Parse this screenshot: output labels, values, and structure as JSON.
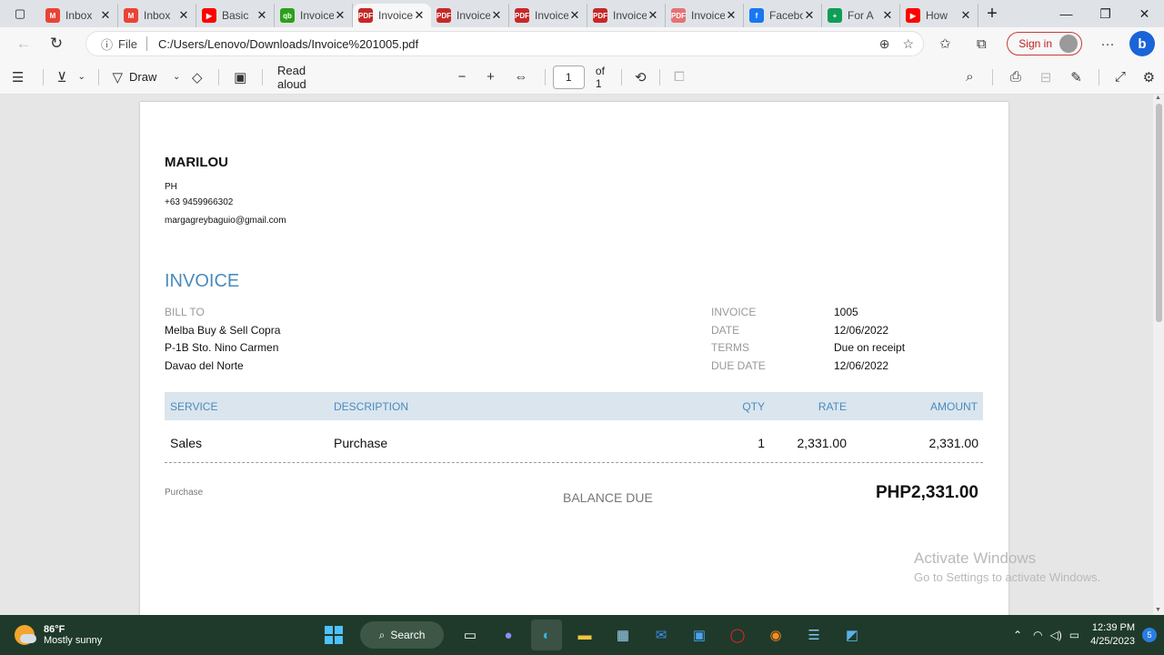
{
  "browser": {
    "tabs": [
      {
        "title": "Inbox",
        "favicon": "gmail-icon",
        "color": "#ea4335",
        "glyph": "M"
      },
      {
        "title": "Inbox",
        "favicon": "gmail-icon",
        "color": "#ea4335",
        "glyph": "M"
      },
      {
        "title": "Basic",
        "favicon": "youtube-icon",
        "color": "#ff0000",
        "glyph": "▶"
      },
      {
        "title": "Invoice",
        "favicon": "quickbooks-icon",
        "color": "#2ca01c",
        "glyph": "qb"
      },
      {
        "title": "Invoice",
        "favicon": "pdf-icon",
        "color": "#c62828",
        "glyph": "PDF",
        "active": true
      },
      {
        "title": "Invoice",
        "favicon": "pdf-icon",
        "color": "#c62828",
        "glyph": "PDF"
      },
      {
        "title": "Invoice",
        "favicon": "pdf-icon",
        "color": "#c62828",
        "glyph": "PDF"
      },
      {
        "title": "Invoice",
        "favicon": "pdf-icon",
        "color": "#c62828",
        "glyph": "PDF"
      },
      {
        "title": "Invoice",
        "favicon": "pdf-icon",
        "color": "#e57373",
        "glyph": "PDF"
      },
      {
        "title": "Facebook",
        "favicon": "facebook-icon",
        "color": "#1877f2",
        "glyph": "f"
      },
      {
        "title": "For A",
        "favicon": "sheets-icon",
        "color": "#0f9d58",
        "glyph": "+"
      },
      {
        "title": "How",
        "favicon": "youtube-icon",
        "color": "#ff0000",
        "glyph": "▶"
      }
    ],
    "address": {
      "scheme_label": "File",
      "url": "C:/Users/Lenovo/Downloads/Invoice%201005.pdf"
    },
    "signin_label": "Sign in"
  },
  "pdf_toolbar": {
    "draw_label": "Draw",
    "read_aloud_label": "Read aloud",
    "page_number": "1",
    "page_total_label": "of 1"
  },
  "invoice": {
    "sender": {
      "name": "MARILOU",
      "country": "PH",
      "phone": "+63 9459966302",
      "email": "margagreybaguio@gmail.com"
    },
    "title": "INVOICE",
    "bill_to": {
      "label": "BILL TO",
      "lines": [
        "Melba Buy & Sell Copra",
        "P-1B Sto. Nino Carmen",
        "Davao del Norte"
      ]
    },
    "meta": [
      {
        "label": "INVOICE",
        "value": "1005"
      },
      {
        "label": "DATE",
        "value": "12/06/2022"
      },
      {
        "label": "TERMS",
        "value": "Due on receipt"
      },
      {
        "label": "DUE DATE",
        "value": "12/06/2022"
      }
    ],
    "columns": {
      "service": "SERVICE",
      "description": "DESCRIPTION",
      "qty": "QTY",
      "rate": "RATE",
      "amount": "AMOUNT"
    },
    "rows": [
      {
        "service": "Sales",
        "description": "Purchase",
        "qty": "1",
        "rate": "2,331.00",
        "amount": "2,331.00"
      }
    ],
    "footer_note": "Purchase",
    "balance_label": "BALANCE DUE",
    "balance_value": "PHP2,331.00",
    "accent_color": "#4a8bbd"
  },
  "watermark": {
    "line1": "Activate Windows",
    "line2": "Go to Settings to activate Windows."
  },
  "taskbar": {
    "temperature": "86°F",
    "condition": "Mostly sunny",
    "search_label": "Search",
    "time": "12:39 PM",
    "date": "4/25/2023",
    "notification_count": "5"
  }
}
